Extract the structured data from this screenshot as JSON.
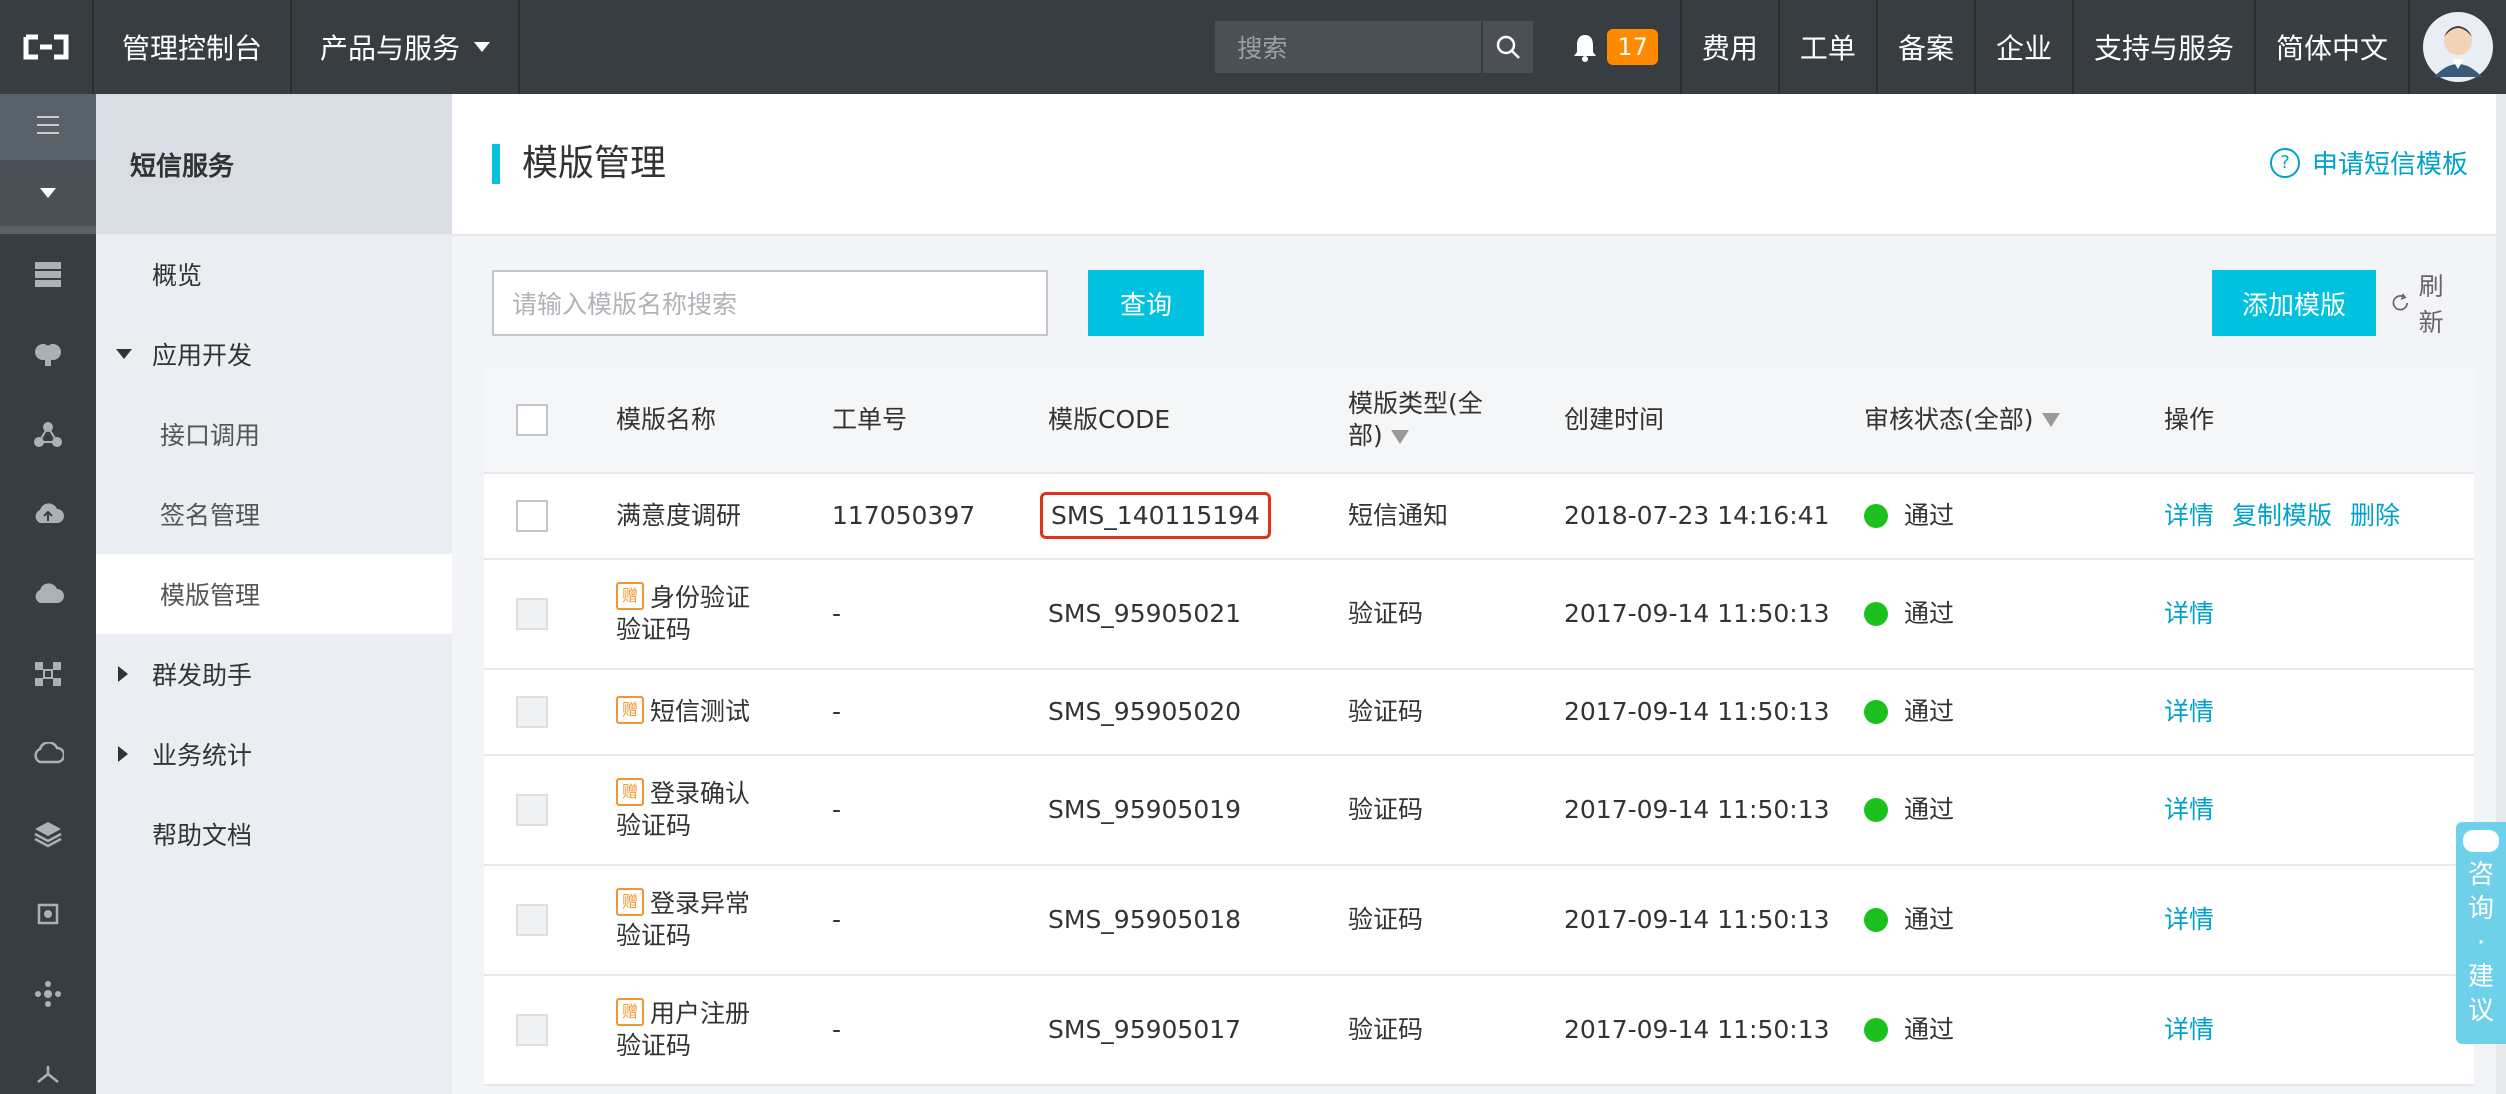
{
  "topbar": {
    "console": "管理控制台",
    "products": "产品与服务",
    "search_placeholder": "搜索",
    "notifications": "17",
    "links": [
      "费用",
      "工单",
      "备案",
      "企业",
      "支持与服务",
      "简体中文"
    ]
  },
  "sidebar": {
    "title": "短信服务",
    "items": [
      {
        "label": "概览"
      },
      {
        "label": "应用开发"
      },
      {
        "label": "接口调用"
      },
      {
        "label": "签名管理"
      },
      {
        "label": "模版管理"
      },
      {
        "label": "群发助手"
      },
      {
        "label": "业务统计"
      },
      {
        "label": "帮助文档"
      }
    ]
  },
  "page": {
    "title": "模版管理",
    "apply_link": "申请短信模板",
    "search_placeholder": "请输入模版名称搜索",
    "query_button": "查询",
    "add_button": "添加模版",
    "refresh_button": "刷新"
  },
  "table": {
    "headers": {
      "name": "模版名称",
      "work_order": "工单号",
      "code": "模版CODE",
      "type_line1": "模版类型(全",
      "type_line2": "部)",
      "created": "创建时间",
      "status": "审核状态(全部)",
      "ops": "操作"
    },
    "rows": [
      {
        "name1": "满意度调研",
        "name2": "",
        "work_order": "117050397",
        "code": "SMS_140115194",
        "type": "短信通知",
        "created": "2018-07-23 14:16:41",
        "status": "通过",
        "op_detail": "详情",
        "op_copy": "复制模版",
        "op_delete": "删除"
      },
      {
        "name1": "身份验证",
        "name2": "验证码",
        "work_order": "-",
        "code": "SMS_95905021",
        "type": "验证码",
        "created": "2017-09-14 11:50:13",
        "status": "通过",
        "op_detail": "详情"
      },
      {
        "name1": "短信测试",
        "name2": "",
        "work_order": "-",
        "code": "SMS_95905020",
        "type": "验证码",
        "created": "2017-09-14 11:50:13",
        "status": "通过",
        "op_detail": "详情"
      },
      {
        "name1": "登录确认",
        "name2": "验证码",
        "work_order": "-",
        "code": "SMS_95905019",
        "type": "验证码",
        "created": "2017-09-14 11:50:13",
        "status": "通过",
        "op_detail": "详情"
      },
      {
        "name1": "登录异常",
        "name2": "验证码",
        "work_order": "-",
        "code": "SMS_95905018",
        "type": "验证码",
        "created": "2017-09-14 11:50:13",
        "status": "通过",
        "op_detail": "详情"
      },
      {
        "name1": "用户注册",
        "name2": "验证码",
        "work_order": "-",
        "code": "SMS_95905017",
        "type": "验证码",
        "created": "2017-09-14 11:50:13",
        "status": "通过",
        "op_detail": "详情"
      }
    ],
    "gift_glyph": "赠"
  },
  "consult": {
    "chars": [
      "咨",
      "询",
      "·",
      "建",
      "议"
    ]
  },
  "colors": {
    "accent": "#00c1de",
    "link": "#00a2ca",
    "topbar": "#373d41",
    "success": "#1dc11d",
    "highlight": "#e0321b"
  }
}
